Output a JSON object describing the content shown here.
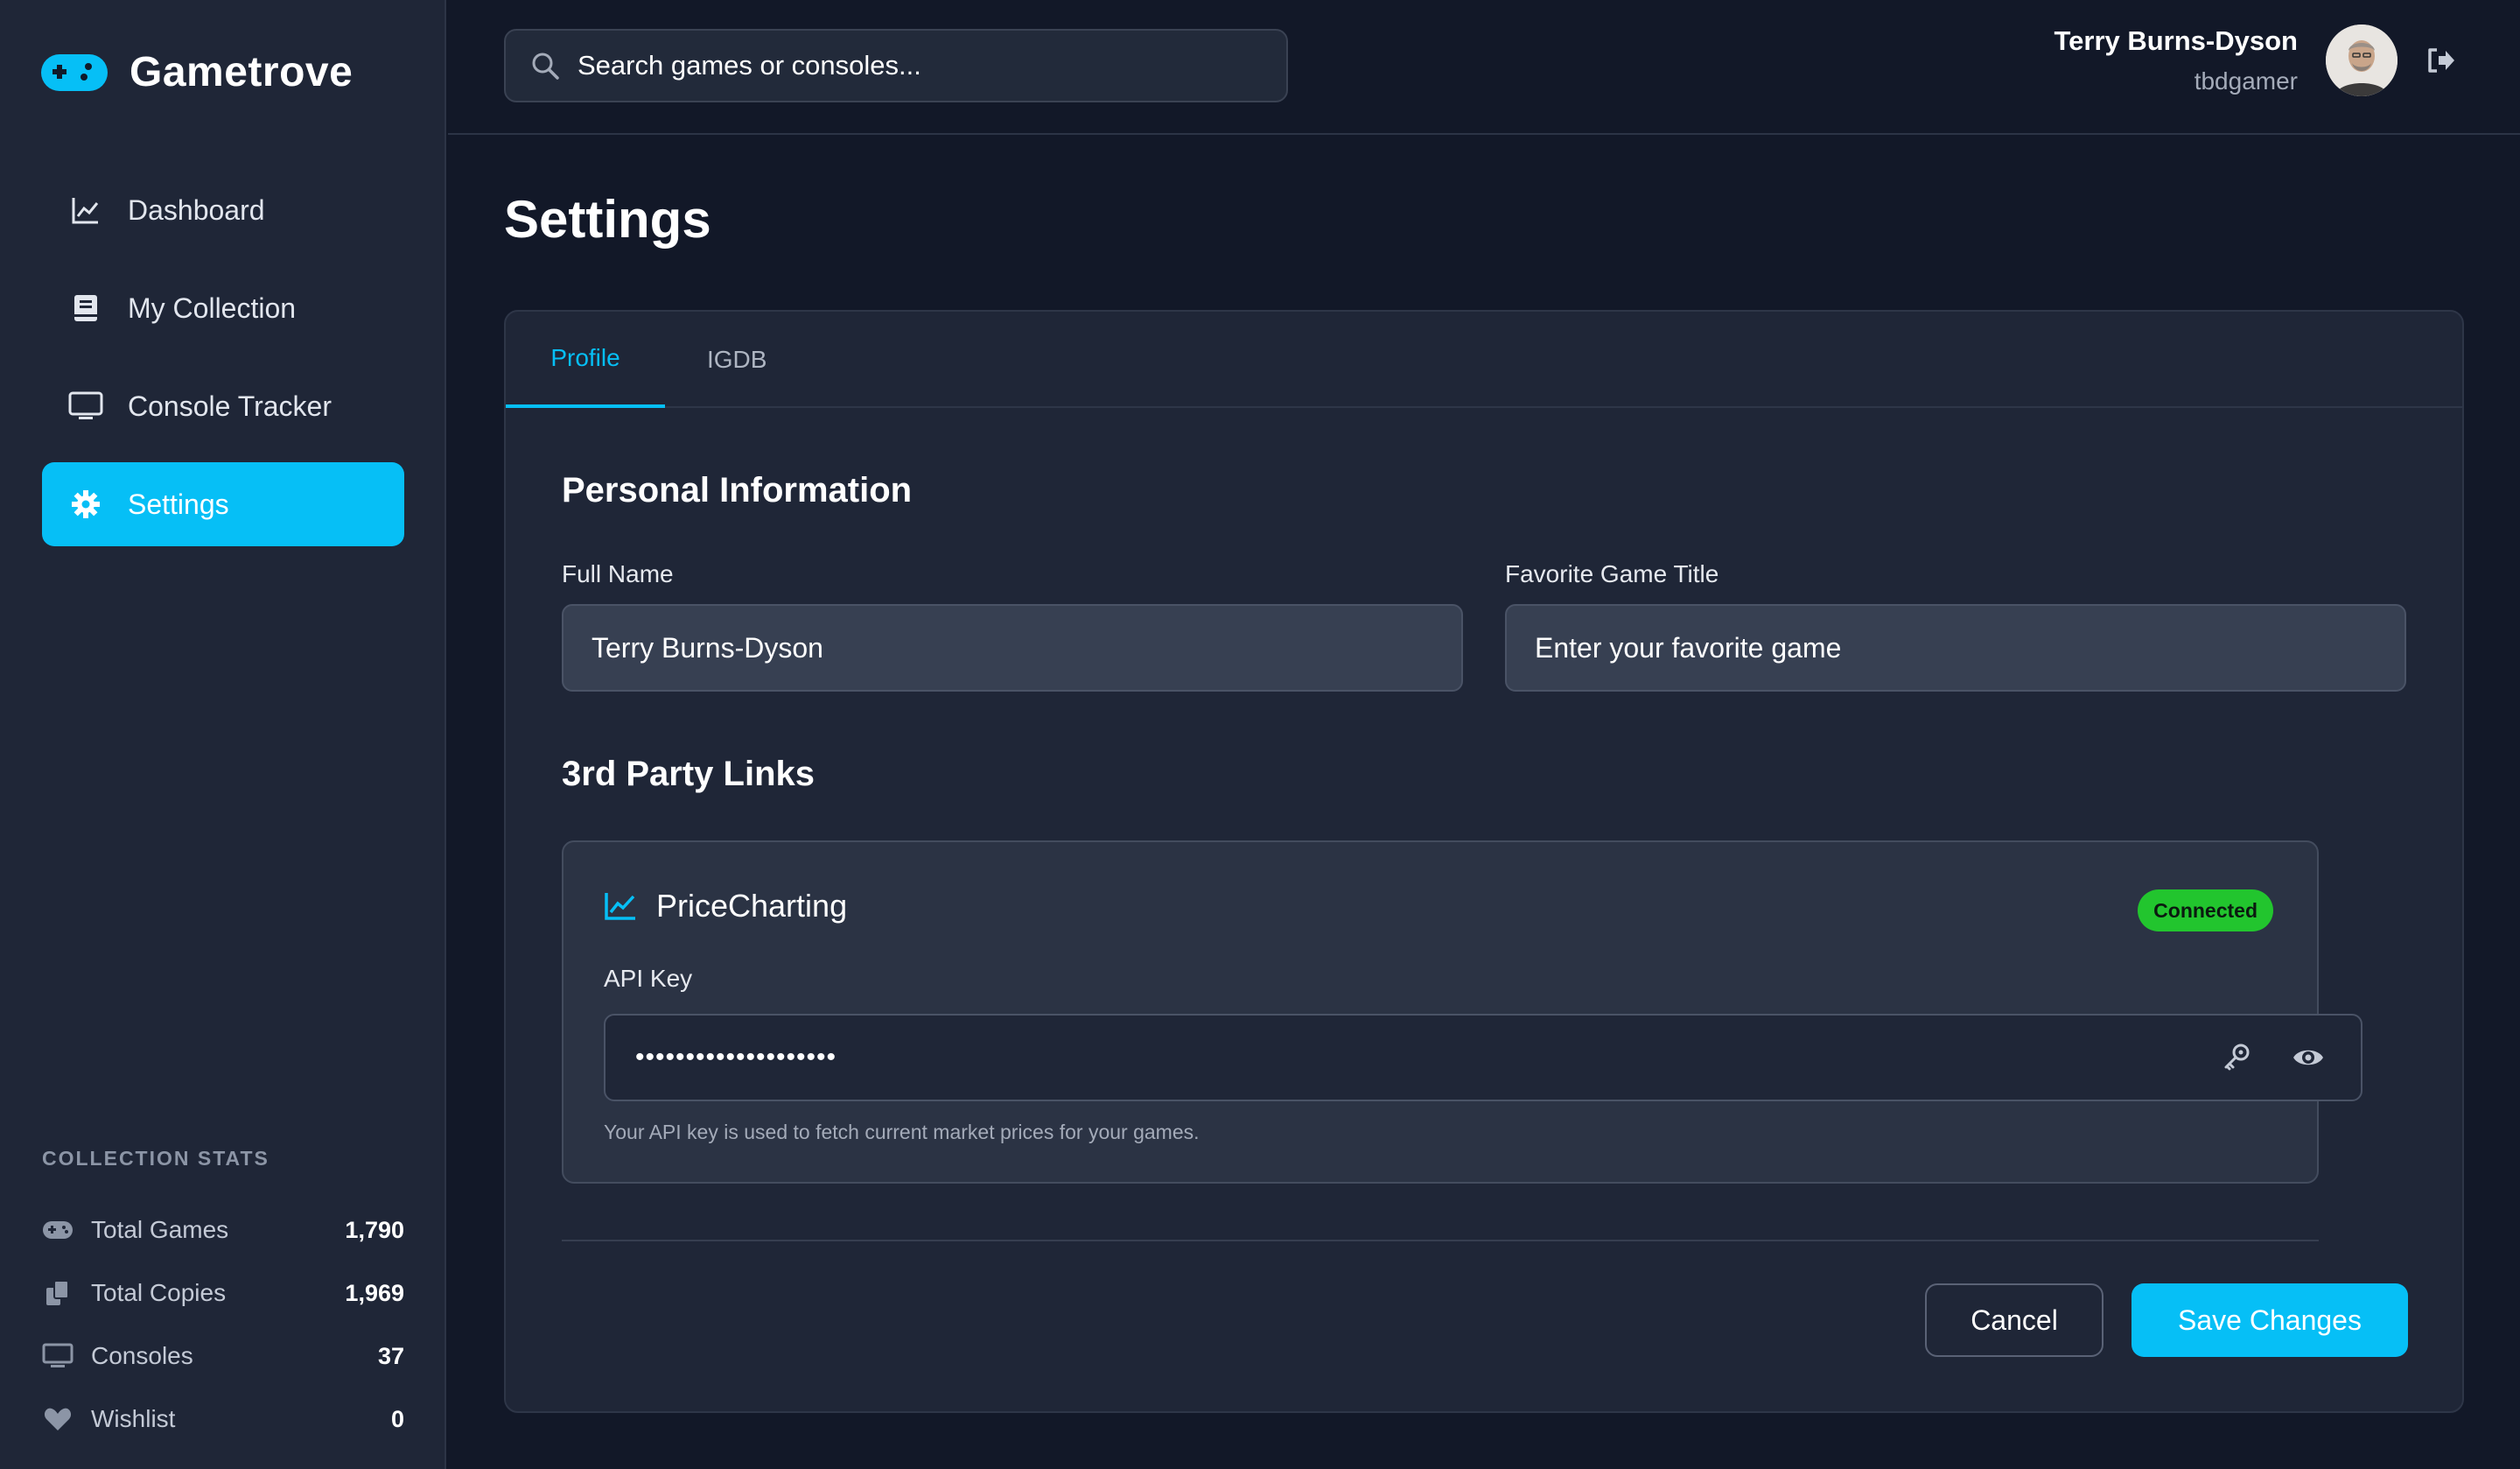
{
  "app": {
    "name": "Gametrove"
  },
  "colors": {
    "accent": "#06bff6",
    "success": "#22c52e",
    "background": "#121828",
    "panel": "#1f2637"
  },
  "sidebar": {
    "items": [
      {
        "label": "Dashboard",
        "icon": "chart-line-icon",
        "active": false
      },
      {
        "label": "My Collection",
        "icon": "book-icon",
        "active": false
      },
      {
        "label": "Console Tracker",
        "icon": "monitor-icon",
        "active": false
      },
      {
        "label": "Settings",
        "icon": "gear-icon",
        "active": true
      }
    ],
    "stats": {
      "title": "COLLECTION STATS",
      "rows": [
        {
          "label": "Total Games",
          "value": "1,790",
          "icon": "gamepad-icon"
        },
        {
          "label": "Total Copies",
          "value": "1,969",
          "icon": "copy-icon"
        },
        {
          "label": "Consoles",
          "value": "37",
          "icon": "monitor-icon"
        },
        {
          "label": "Wishlist",
          "value": "0",
          "icon": "heart-icon"
        }
      ]
    }
  },
  "header": {
    "search_placeholder": "Search games or consoles...",
    "user": {
      "name": "Terry Burns-Dyson",
      "handle": "tbdgamer"
    }
  },
  "main": {
    "title": "Settings",
    "tabs": [
      {
        "label": "Profile",
        "active": true
      },
      {
        "label": "IGDB",
        "active": false
      }
    ],
    "personal": {
      "title": "Personal Information",
      "full_name_label": "Full Name",
      "full_name_value": "Terry Burns-Dyson",
      "favorite_label": "Favorite Game Title",
      "favorite_placeholder": "Enter your favorite game"
    },
    "links": {
      "title": "3rd Party Links",
      "pricecharting": {
        "name": "PriceCharting",
        "status": "Connected",
        "api_label": "API Key",
        "api_value": "••••••••••••••••••••",
        "help": "Your API key is used to fetch current market prices for your games."
      }
    },
    "actions": {
      "cancel": "Cancel",
      "save": "Save Changes"
    }
  }
}
